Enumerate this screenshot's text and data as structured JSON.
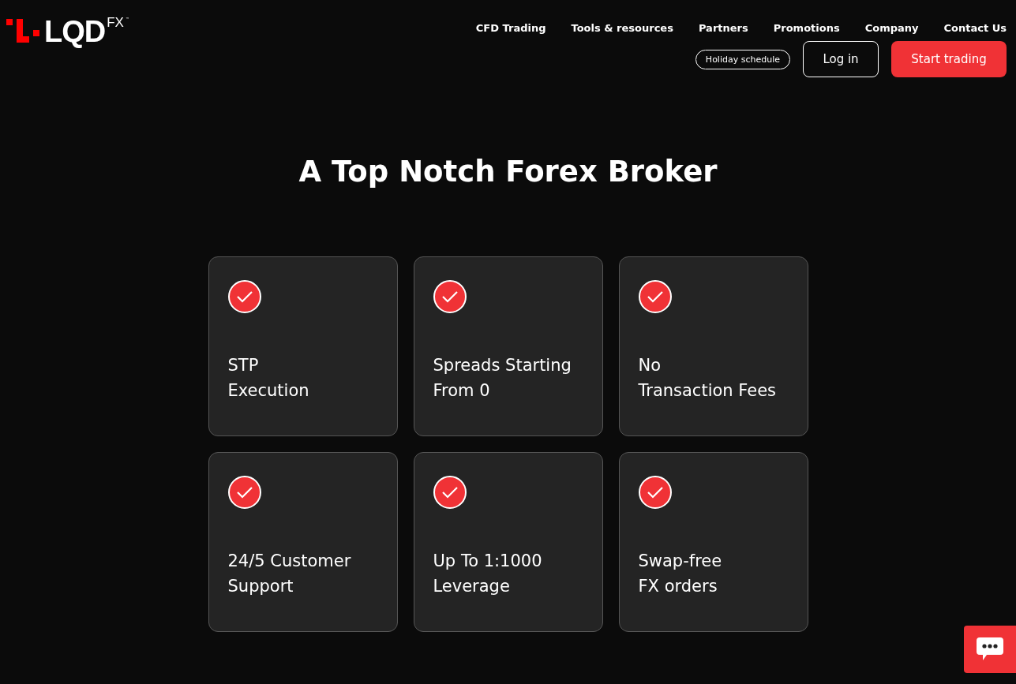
{
  "logo": {
    "name": "LQD",
    "suffix": "FX",
    "mark": "™"
  },
  "nav": [
    "CFD Trading",
    "Tools & resources",
    "Partners",
    "Promotions",
    "Company",
    "Contact Us"
  ],
  "actions": {
    "holiday": "Holiday schedule",
    "login": "Log in",
    "start": "Start trading"
  },
  "heading": "A Top Notch Forex Broker",
  "features": [
    {
      "title": "STP\nExecution"
    },
    {
      "title": "Spreads Starting\nFrom 0"
    },
    {
      "title": "No\nTransaction Fees"
    },
    {
      "title": "24/5 Customer\nSupport"
    },
    {
      "title": "Up To 1:1000\nLeverage"
    },
    {
      "title": "Swap-free\nFX orders"
    }
  ]
}
